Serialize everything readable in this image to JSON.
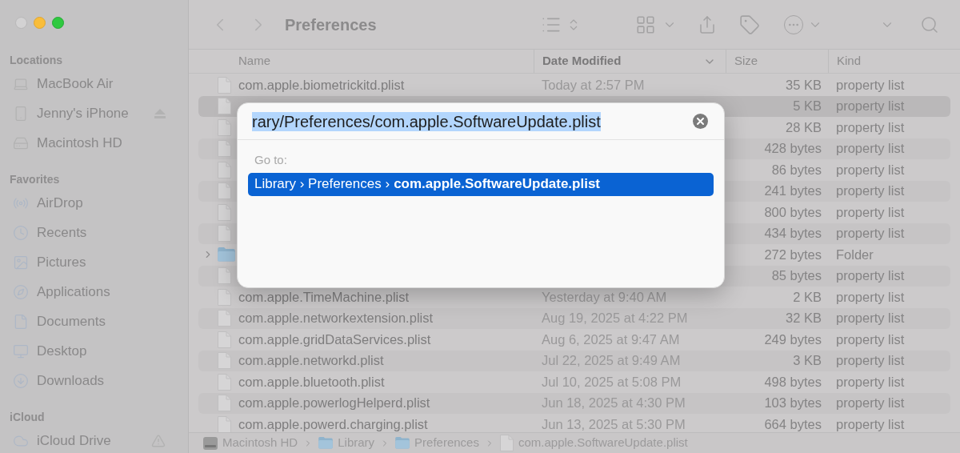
{
  "window": {
    "title": "Preferences"
  },
  "sidebar": {
    "sections": [
      {
        "title": "Locations",
        "items": [
          {
            "label": "MacBook Air"
          },
          {
            "label": "Jenny's iPhone"
          },
          {
            "label": "Macintosh HD"
          }
        ]
      },
      {
        "title": "Favorites",
        "items": [
          {
            "label": "AirDrop"
          },
          {
            "label": "Recents"
          },
          {
            "label": "Pictures"
          },
          {
            "label": "Applications"
          },
          {
            "label": "Documents"
          },
          {
            "label": "Desktop"
          },
          {
            "label": "Downloads"
          }
        ]
      },
      {
        "title": "iCloud",
        "items": [
          {
            "label": "iCloud Drive"
          }
        ]
      }
    ]
  },
  "table": {
    "columns": [
      {
        "label": "Name",
        "sorted": false
      },
      {
        "label": "Date Modified",
        "sorted": true
      },
      {
        "label": "Size",
        "sorted": false
      },
      {
        "label": "Kind",
        "sorted": false
      }
    ],
    "rows": [
      {
        "kind": "file",
        "selected": false,
        "name": "com.apple.biometrickitd.plist",
        "date": "Today at 2:57 PM",
        "size": "35 KB",
        "type": "property list"
      },
      {
        "kind": "file",
        "selected": true,
        "size": "5 KB",
        "type": "property list"
      },
      {
        "kind": "file",
        "selected": false,
        "size": "28 KB",
        "type": "property list"
      },
      {
        "kind": "file",
        "selected": false,
        "size": "428 bytes",
        "type": "property list"
      },
      {
        "kind": "file",
        "selected": false,
        "size": "86 bytes",
        "type": "property list"
      },
      {
        "kind": "file",
        "selected": false,
        "size": "241 bytes",
        "type": "property list"
      },
      {
        "kind": "file",
        "selected": false,
        "size": "800 bytes",
        "type": "property list"
      },
      {
        "kind": "file",
        "selected": false,
        "size": "434 bytes",
        "type": "property list"
      },
      {
        "kind": "folder",
        "selected": false,
        "size": "272 bytes",
        "type": "Folder"
      },
      {
        "kind": "file",
        "selected": false,
        "size": "85 bytes",
        "type": "property list"
      },
      {
        "kind": "file",
        "selected": false,
        "name": "com.apple.TimeMachine.plist",
        "date": "Yesterday at 9:40 AM",
        "size": "2 KB",
        "type": "property list"
      },
      {
        "kind": "file",
        "selected": false,
        "name": "com.apple.networkextension.plist",
        "date": "Aug 19, 2025 at 4:22 PM",
        "size": "32 KB",
        "type": "property list"
      },
      {
        "kind": "file",
        "selected": false,
        "name": "com.apple.gridDataServices.plist",
        "date": "Aug 6, 2025 at 9:47 AM",
        "size": "249 bytes",
        "type": "property list"
      },
      {
        "kind": "file",
        "selected": false,
        "name": "com.apple.networkd.plist",
        "date": "Jul 22, 2025 at 9:49 AM",
        "size": "3 KB",
        "type": "property list"
      },
      {
        "kind": "file",
        "selected": false,
        "name": "com.apple.bluetooth.plist",
        "date": "Jul 10, 2025 at 5:08 PM",
        "size": "498 bytes",
        "type": "property list"
      },
      {
        "kind": "file",
        "selected": false,
        "name": "com.apple.powerlogHelperd.plist",
        "date": "Jun 18, 2025 at 4:30 PM",
        "size": "103 bytes",
        "type": "property list"
      },
      {
        "kind": "file",
        "selected": false,
        "name": "com.apple.powerd.charging.plist",
        "date": "Jun 13, 2025 at 5:30 PM",
        "size": "664 bytes",
        "type": "property list"
      }
    ]
  },
  "dialog": {
    "input": "rary/Preferences/com.apple.SoftwareUpdate.plist",
    "heading": "Go to:",
    "results": [
      {
        "path": "Library › Preferences ›",
        "target": "com.apple.SoftwareUpdate.plist",
        "selected": true
      }
    ]
  },
  "path_bar": [
    {
      "kind": "disk",
      "label": "Macintosh HD"
    },
    {
      "kind": "folder",
      "label": "Library"
    },
    {
      "kind": "folder",
      "label": "Preferences"
    },
    {
      "kind": "file",
      "label": "com.apple.SoftwareUpdate.plist"
    }
  ]
}
